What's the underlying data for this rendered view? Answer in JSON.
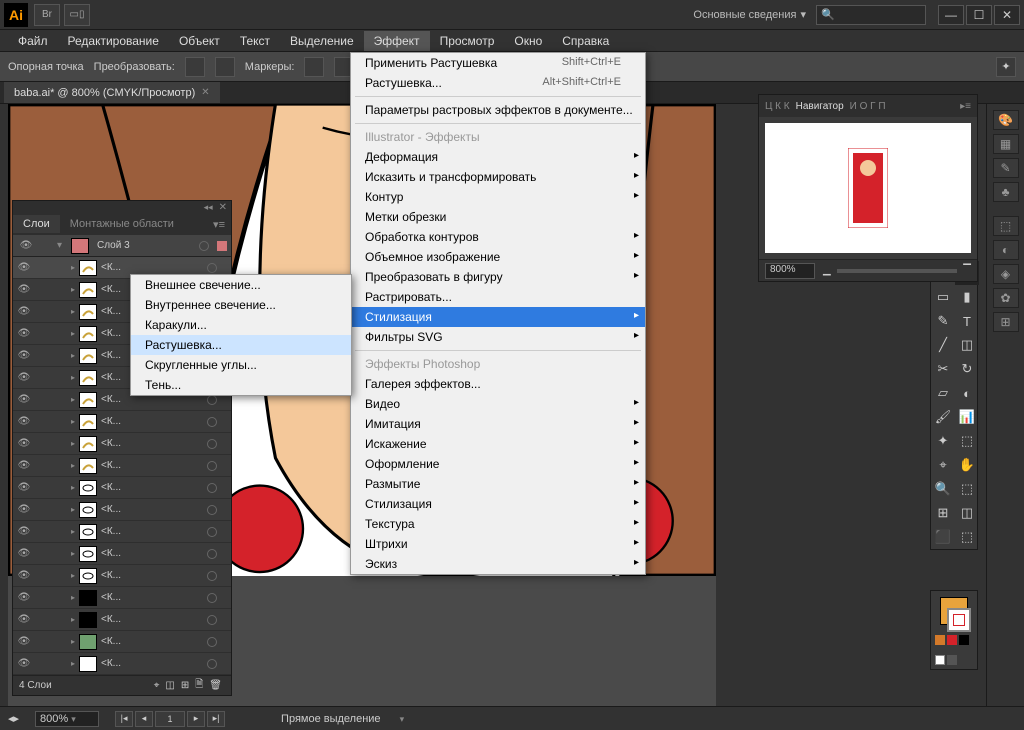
{
  "titlebar": {
    "logo": "Ai",
    "br_btn": "Br",
    "workspace_label": "Основные сведения"
  },
  "menubar": {
    "items": [
      "Файл",
      "Редактирование",
      "Объект",
      "Текст",
      "Выделение",
      "Эффект",
      "Просмотр",
      "Окно",
      "Справка"
    ],
    "active_index": 5
  },
  "controlbar": {
    "anchor_label": "Опорная точка",
    "transform_label": "Преобразовать:",
    "markers_label": "Маркеры:"
  },
  "doctab": {
    "title": "baba.ai* @ 800% (CMYK/Просмотр)"
  },
  "effect_menu": {
    "apply": "Применить Растушевка",
    "apply_sc": "Shift+Ctrl+E",
    "feather": "Растушевка...",
    "feather_sc": "Alt+Shift+Ctrl+E",
    "raster_settings": "Параметры растровых эффектов в документе...",
    "section_ai": "Illustrator - Эффекты",
    "items_ai": [
      "Деформация",
      "Исказить и трансформировать",
      "Контур",
      "Метки обрезки",
      "Обработка контуров",
      "Объемное изображение",
      "Преобразовать в фигуру",
      "Растрировать...",
      "Стилизация",
      "Фильтры SVG"
    ],
    "highlight_index": 8,
    "section_ps": "Эффекты Photoshop",
    "items_ps": [
      "Галерея эффектов...",
      "Видео",
      "Имитация",
      "Искажение",
      "Оформление",
      "Размытие",
      "Стилизация",
      "Текстура",
      "Штрихи",
      "Эскиз"
    ]
  },
  "stylize_submenu": {
    "items": [
      "Внешнее свечение...",
      "Внутреннее свечение...",
      "Каракули...",
      "Растушевка...",
      "Скругленные углы...",
      "Тень..."
    ],
    "hover_index": 3
  },
  "layers_panel": {
    "tab1": "Слои",
    "tab2": "Монтажные области",
    "top_layer": "Слой 3",
    "sublayer_name": "<К...",
    "sublayer_count": 19,
    "footer": "4 Слои"
  },
  "navigator": {
    "tabs_left": "Ц К К",
    "tab_active": "Навигатор",
    "tabs_right": "И О Г П",
    "zoom": "800%"
  },
  "statusbar": {
    "zoom": "800%",
    "page": "1",
    "tool": "Прямое выделение"
  },
  "colors": {
    "fill": "#e8a33c",
    "stroke": "#ffffff"
  }
}
